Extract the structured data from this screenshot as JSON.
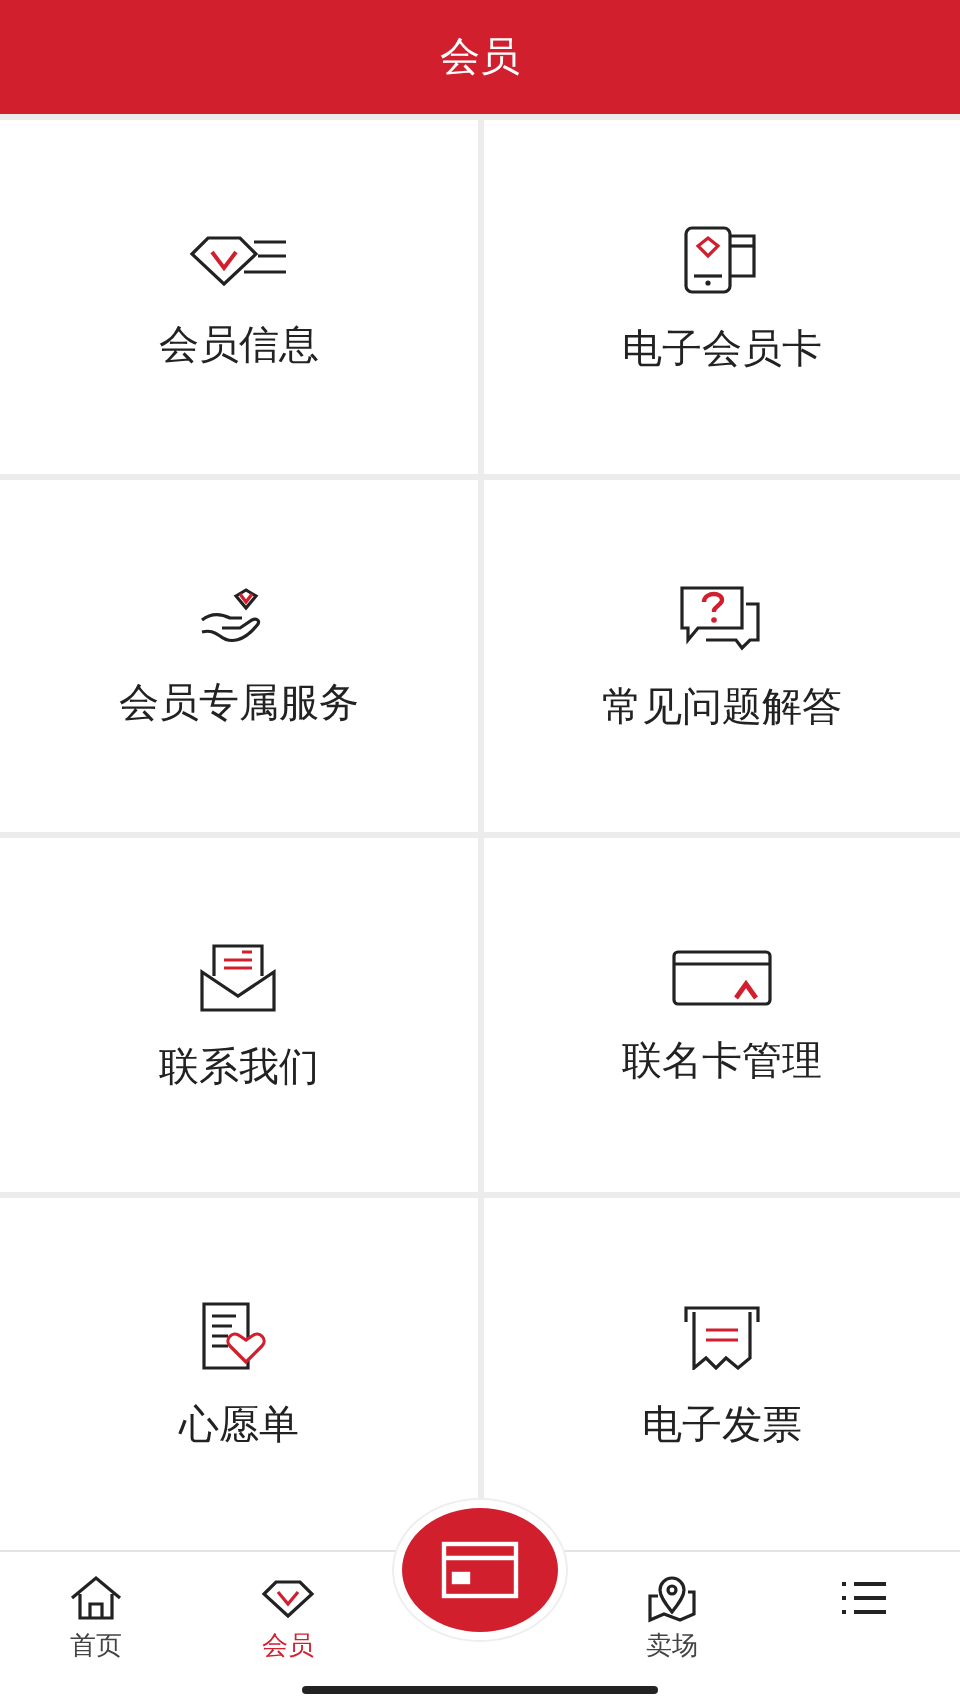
{
  "header": {
    "title": "会员"
  },
  "menu": [
    {
      "label": "会员信息"
    },
    {
      "label": "电子会员卡"
    },
    {
      "label": "会员专属服务"
    },
    {
      "label": "常见问题解答"
    },
    {
      "label": "联系我们"
    },
    {
      "label": "联名卡管理"
    },
    {
      "label": "心愿单"
    },
    {
      "label": "电子发票"
    }
  ],
  "tab_bar": [
    {
      "kind": "tab",
      "label": "首页",
      "selected": false
    },
    {
      "kind": "tab",
      "label": "会员",
      "selected": true
    },
    {
      "kind": "center"
    },
    {
      "kind": "tab",
      "label": "卖场",
      "selected": false
    },
    {
      "kind": "tab",
      "selected": false
    }
  ]
}
